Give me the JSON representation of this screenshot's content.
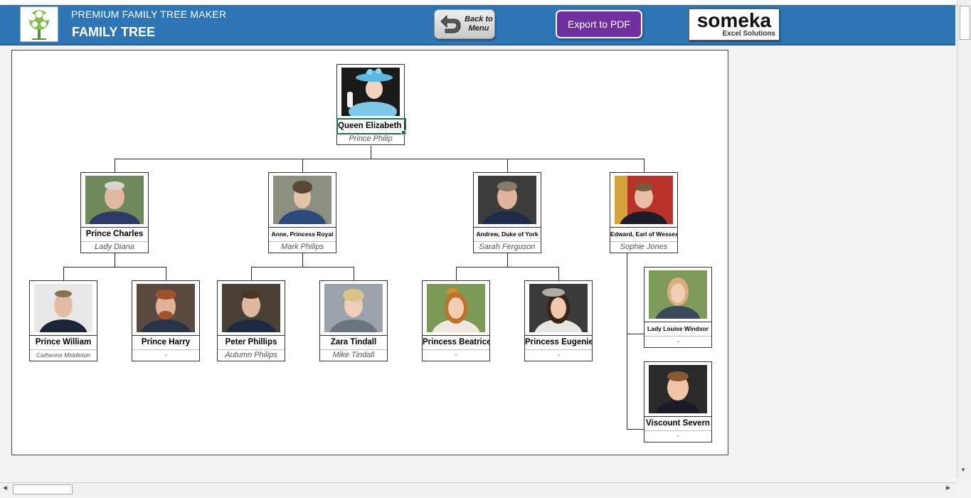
{
  "header": {
    "app_title": "PREMIUM FAMILY TREE MAKER",
    "page_title": "FAMILY TREE",
    "back_button_label": "Back to\nMenu",
    "export_button_label": "Export to PDF",
    "brand_name": "someka",
    "brand_tagline": "Excel Solutions"
  },
  "colors": {
    "header_blue": "#2e75b6",
    "export_purple": "#7030a0",
    "selection_green": "#217346"
  },
  "tree": {
    "root": {
      "name": "Queen Elizabeth II",
      "spouse": "Prince Philip"
    },
    "children": [
      {
        "name": "Prince Charles",
        "spouse": "Lady Diana"
      },
      {
        "name": "Anne, Princess Royal",
        "spouse": "Mark Philips"
      },
      {
        "name": "Andrew, Duke of York",
        "spouse": "Sarah Ferguson"
      },
      {
        "name": "Edward, Earl of Wessex",
        "spouse": "Sophie Jones"
      }
    ],
    "grandchildren": [
      {
        "name": "Prince William",
        "spouse": "Catherine Middleton"
      },
      {
        "name": "Prince Harry",
        "spouse": "-"
      },
      {
        "name": "Peter Phillips",
        "spouse": "Autumn Philips"
      },
      {
        "name": "Zara Tindall",
        "spouse": "Mike Tindall"
      },
      {
        "name": "Princess Beatrice",
        "spouse": "-"
      },
      {
        "name": "Princess Eugenie",
        "spouse": "-"
      },
      {
        "name": "Lady Louise Windsor",
        "spouse": "-"
      },
      {
        "name": "Viscount Severn",
        "spouse": "-"
      }
    ]
  }
}
